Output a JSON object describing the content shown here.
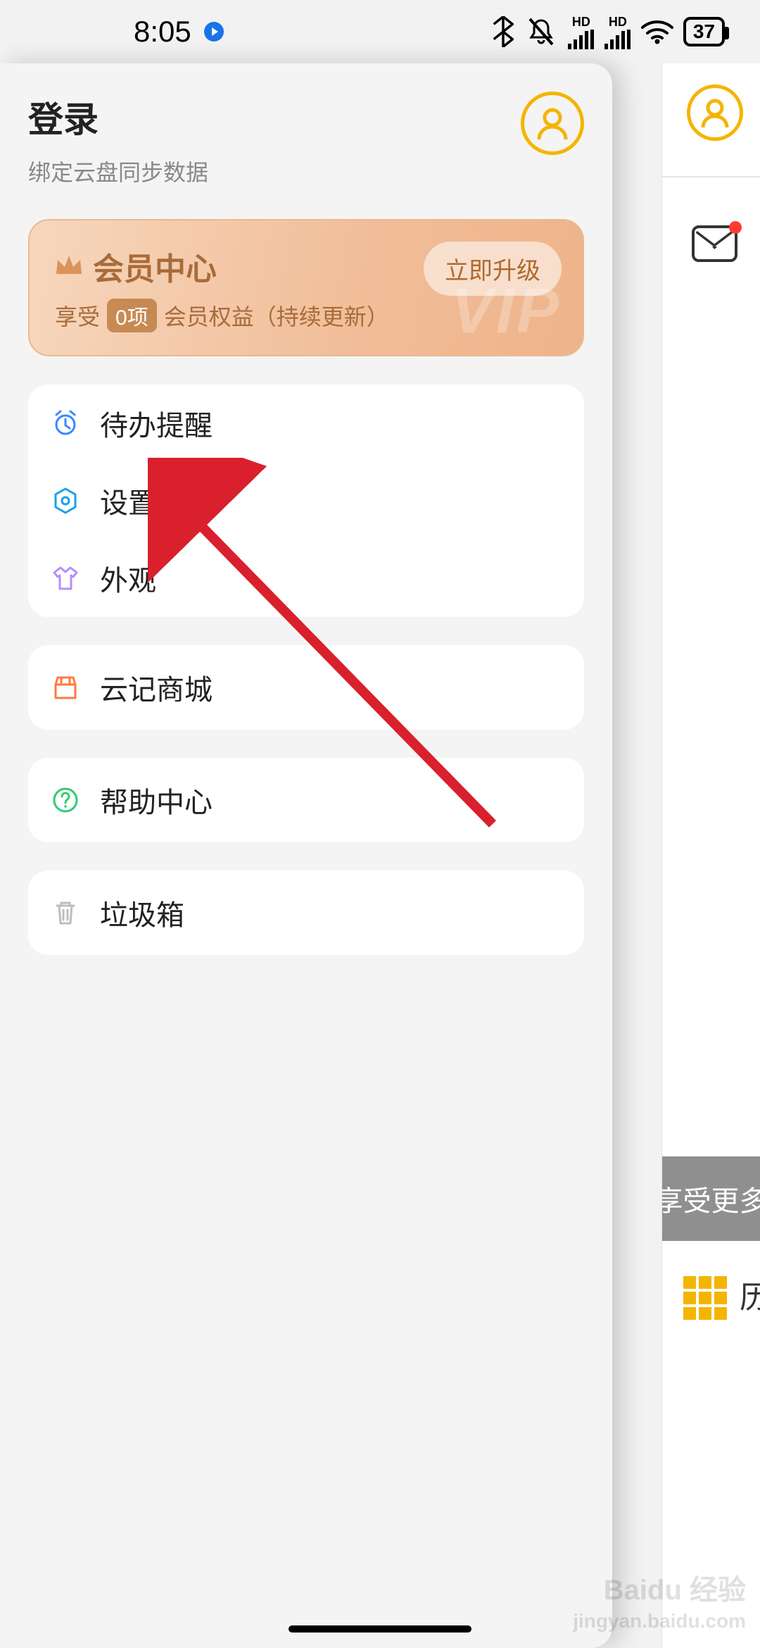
{
  "status": {
    "time": "8:05",
    "battery": "37",
    "signal1_label": "HD",
    "signal2_label": "HD"
  },
  "drawer": {
    "login_title": "登录",
    "login_subtitle": "绑定云盘同步数据"
  },
  "vip": {
    "title": "会员中心",
    "sub_prefix": "享受",
    "pill": "0项",
    "sub_suffix": "会员权益（持续更新）",
    "button": "立即升级",
    "watermark": "VIP"
  },
  "menu_group1": [
    {
      "label": "待办提醒",
      "icon": "alarm-icon",
      "color": "#3a88ff"
    },
    {
      "label": "设置",
      "icon": "settings-hex-icon",
      "color": "#1aa0e8"
    },
    {
      "label": "外观",
      "icon": "shirt-icon",
      "color": "#b68cff"
    }
  ],
  "menu_shop": {
    "label": "云记商城",
    "icon": "shop-icon",
    "color": "#ff7a3d"
  },
  "menu_help": {
    "label": "帮助中心",
    "icon": "help-icon",
    "color": "#2ecc71"
  },
  "menu_trash": {
    "label": "垃圾箱",
    "icon": "trash-icon",
    "color": "#bdbdbd"
  },
  "peek": {
    "banner": "享受更多",
    "grid_text": "历"
  },
  "watermark": {
    "line1": "Baidu 经验",
    "line2": "jingyan.baidu.com"
  }
}
